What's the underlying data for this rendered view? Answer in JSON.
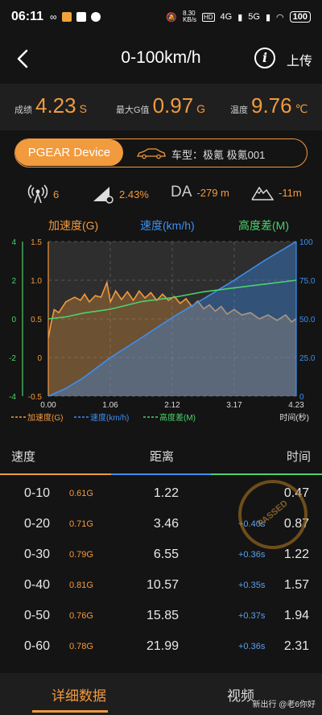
{
  "status": {
    "time": "06:11",
    "net": "8.30\nKB/s",
    "signal1": "4G",
    "signal2": "5G",
    "battery": "100"
  },
  "header": {
    "title": "0-100km/h",
    "upload": "上传"
  },
  "stats": {
    "score_label": "成绩",
    "score_value": "4.23",
    "score_unit": "S",
    "g_label": "最大G值",
    "g_value": "0.97",
    "g_unit": "G",
    "temp_label": "温度",
    "temp_value": "9.76",
    "temp_unit": "℃"
  },
  "device": {
    "button": "PGEAR Device",
    "car": "车型：极氪 极氪001"
  },
  "metrics": {
    "sats": "6",
    "slope": "2.43%",
    "da_label": "DA",
    "da_value": "-279 m",
    "altitude": "-11m"
  },
  "chart_data": {
    "type": "line",
    "legend_top": [
      "加速度(G)",
      "速度(km/h)",
      "高度差(M)"
    ],
    "legend_bottom": [
      "加速度(G)",
      "速度(km/h)",
      "高度差(M)"
    ],
    "xlabel": "时间(秒)",
    "x_ticks": [
      "0.00",
      "1.06",
      "2.12",
      "3.17",
      "4.23"
    ],
    "y_left_outer_ticks": [
      "4",
      "2",
      "0",
      "-2",
      "-4"
    ],
    "y_left_inner_ticks": [
      "1.5",
      "1.0",
      "0.5",
      "0",
      "-0.5"
    ],
    "y_right_ticks": [
      "100",
      "75.0",
      "50.0",
      "25.0",
      "0"
    ],
    "xlim": [
      0,
      4.23
    ],
    "acc_ylim": [
      -0.5,
      1.5
    ],
    "speed_ylim": [
      0,
      100
    ],
    "alt_ylim": [
      -4,
      4
    ],
    "series": [
      {
        "name": "加速度(G)",
        "color": "#f29a3e",
        "x": [
          0,
          0.05,
          0.1,
          0.18,
          0.3,
          0.45,
          0.55,
          0.62,
          0.7,
          0.8,
          0.9,
          1.0,
          1.06,
          1.15,
          1.25,
          1.35,
          1.45,
          1.55,
          1.65,
          1.75,
          1.85,
          1.95,
          2.05,
          2.15,
          2.25,
          2.35,
          2.45,
          2.55,
          2.65,
          2.75,
          2.85,
          2.95,
          3.05,
          3.17,
          3.3,
          3.45,
          3.6,
          3.75,
          3.9,
          4.05,
          4.15,
          4.23
        ],
        "y": [
          0.25,
          0.45,
          0.62,
          0.58,
          0.72,
          0.78,
          0.74,
          0.82,
          0.72,
          0.8,
          0.78,
          0.97,
          0.72,
          0.86,
          0.75,
          0.85,
          0.74,
          0.86,
          0.77,
          0.84,
          0.74,
          0.82,
          0.74,
          0.79,
          0.7,
          0.76,
          0.66,
          0.73,
          0.63,
          0.68,
          0.6,
          0.66,
          0.56,
          0.62,
          0.55,
          0.58,
          0.5,
          0.55,
          0.48,
          0.55,
          0.46,
          0.5
        ]
      },
      {
        "name": "速度(km/h)",
        "color": "#3d8ff0",
        "x": [
          0,
          0.3,
          0.6,
          1.06,
          1.6,
          2.12,
          2.65,
          3.17,
          3.7,
          4.23
        ],
        "y": [
          0,
          5,
          12,
          25,
          38,
          51,
          63,
          75,
          88,
          100
        ]
      },
      {
        "name": "高度差(M)",
        "color": "#4bd26b",
        "x": [
          0,
          0.3,
          0.6,
          1.06,
          1.6,
          2.12,
          2.65,
          3.17,
          3.7,
          4.23
        ],
        "y": [
          0,
          0.1,
          0.3,
          0.5,
          0.9,
          1.1,
          1.4,
          1.6,
          1.8,
          2.0
        ]
      }
    ]
  },
  "table": {
    "headers": {
      "speed": "速度",
      "distance": "距离",
      "time": "时间"
    },
    "rows": [
      {
        "range": "0-10",
        "g": "0.61G",
        "distance": "1.22",
        "delta": "",
        "time": "0.47"
      },
      {
        "range": "0-20",
        "g": "0.71G",
        "distance": "3.46",
        "delta": "+0.40s",
        "time": "0.87"
      },
      {
        "range": "0-30",
        "g": "0.79G",
        "distance": "6.55",
        "delta": "+0.36s",
        "time": "1.22"
      },
      {
        "range": "0-40",
        "g": "0.81G",
        "distance": "10.57",
        "delta": "+0.35s",
        "time": "1.57"
      },
      {
        "range": "0-50",
        "g": "0.76G",
        "distance": "15.85",
        "delta": "+0.37s",
        "time": "1.94"
      },
      {
        "range": "0-60",
        "g": "0.78G",
        "distance": "21.99",
        "delta": "+0.36s",
        "time": "2.31"
      }
    ]
  },
  "stamp": {
    "text": "PASSED"
  },
  "tabs": {
    "detail": "详细数据",
    "video": "视频"
  },
  "watermark": "新出行 @老6你好"
}
